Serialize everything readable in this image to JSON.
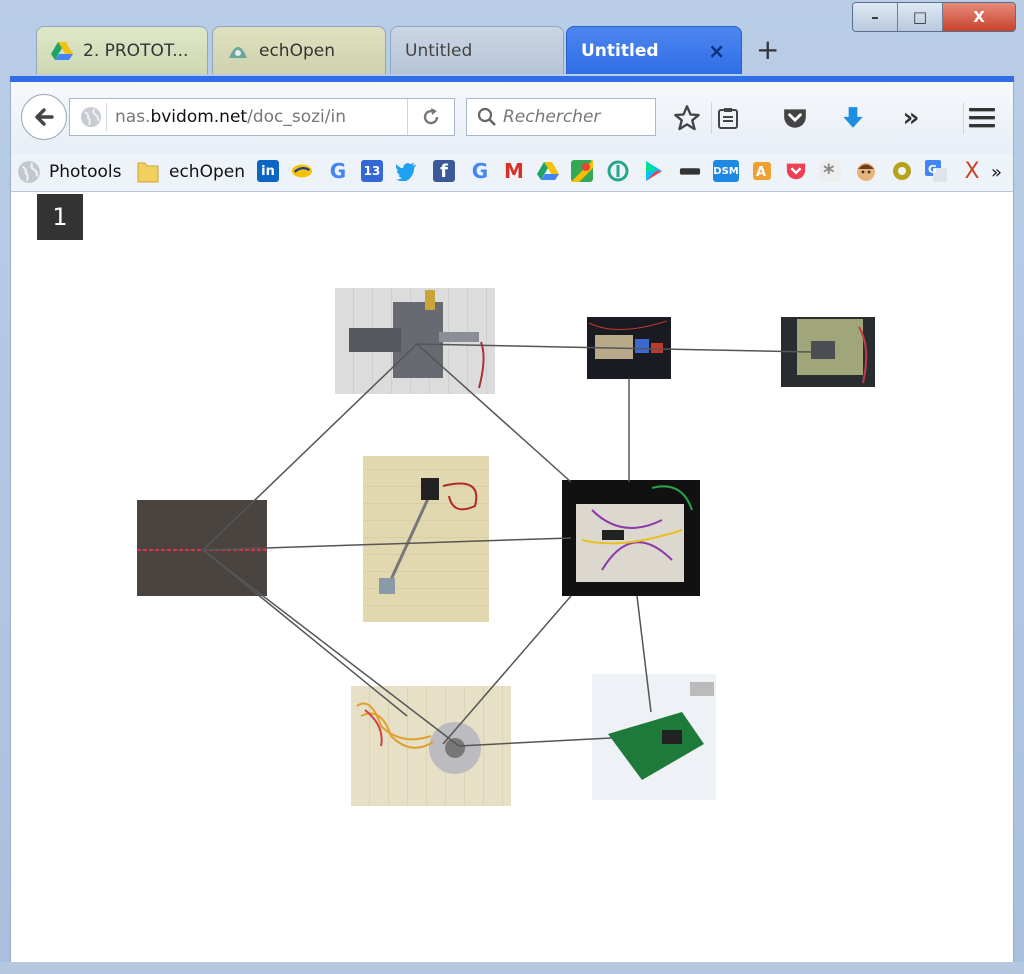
{
  "window": {
    "minimize": "–",
    "maximize": "□",
    "close": "X"
  },
  "tabs": [
    {
      "label": "2. PROTOT...",
      "icon": "google-drive-icon"
    },
    {
      "label": "echOpen",
      "icon": "echopen-icon"
    },
    {
      "label": "Untitled",
      "icon": ""
    },
    {
      "label": "Untitled",
      "icon": "",
      "active": true,
      "close": "×"
    }
  ],
  "new_tab": "+",
  "navbar": {
    "url_prefix": "nas.",
    "url_domain": "bvidom.net",
    "url_path": "/doc_sozi/in",
    "search_placeholder": "Rechercher",
    "overflow": "»"
  },
  "bookmarks": {
    "items": [
      {
        "label": "Photools",
        "icon": "globe-icon"
      },
      {
        "label": "echOpen",
        "icon": "folder-icon"
      }
    ],
    "icon_badges": [
      "in",
      "G",
      "13",
      "f",
      "G",
      "M",
      "DSM",
      "X"
    ],
    "overflow": "»"
  },
  "page": {
    "number": "1"
  },
  "colors": {
    "accent": "#2f6ee6",
    "tab_active": "#2f6ee6",
    "close_button": "#c8432d"
  }
}
